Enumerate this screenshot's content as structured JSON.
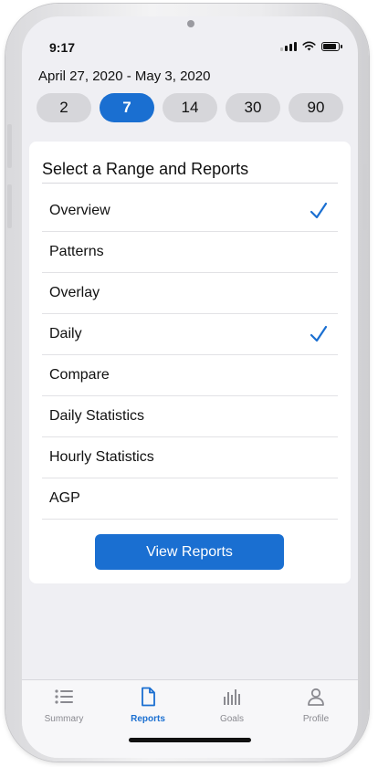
{
  "status_bar": {
    "time": "9:17"
  },
  "date_range": "April 27, 2020 - May 3, 2020",
  "range_options": [
    {
      "label": "2",
      "selected": false
    },
    {
      "label": "7",
      "selected": true
    },
    {
      "label": "14",
      "selected": false
    },
    {
      "label": "30",
      "selected": false
    },
    {
      "label": "90",
      "selected": false
    }
  ],
  "card": {
    "title": "Select a Range and Reports",
    "reports": [
      {
        "label": "Overview",
        "checked": true
      },
      {
        "label": "Patterns",
        "checked": false
      },
      {
        "label": "Overlay",
        "checked": false
      },
      {
        "label": "Daily",
        "checked": true
      },
      {
        "label": "Compare",
        "checked": false
      },
      {
        "label": "Daily Statistics",
        "checked": false
      },
      {
        "label": "Hourly Statistics",
        "checked": false
      },
      {
        "label": "AGP",
        "checked": false
      }
    ],
    "view_button": "View Reports"
  },
  "tabbar": {
    "tabs": [
      {
        "label": "Summary",
        "icon": "list-icon",
        "active": false
      },
      {
        "label": "Reports",
        "icon": "document-icon",
        "active": true
      },
      {
        "label": "Goals",
        "icon": "bar-chart-icon",
        "active": false
      },
      {
        "label": "Profile",
        "icon": "person-icon",
        "active": false
      }
    ]
  },
  "colors": {
    "accent": "#1a6fd1",
    "pill_inactive": "#d6d6da",
    "background": "#efeff3"
  }
}
